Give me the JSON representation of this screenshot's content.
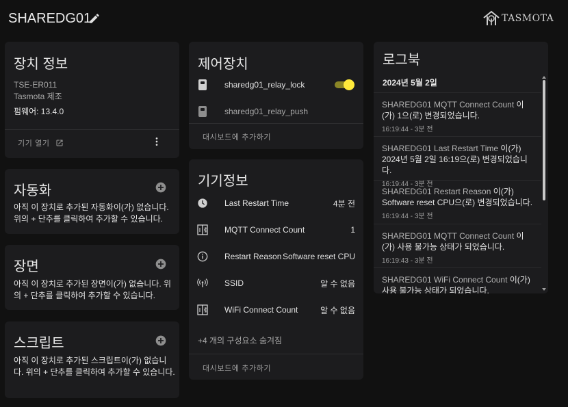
{
  "header": {
    "title": "SHAREDG01",
    "logo_text": "TASMOTA"
  },
  "device_info": {
    "title": "장치 정보",
    "model": "TSE-ER011",
    "manufacturer": "Tasmota 제조",
    "firmware": "펌웨어: 13.4.0",
    "open_device": "기기 열기"
  },
  "automation": {
    "title": "자동화",
    "empty_text": "아직 이 장치로 추가된 자동화이(가) 없습니다. 위의 + 단추를 클릭하여 추가할 수 있습니다."
  },
  "scenes": {
    "title": "장면",
    "empty_text": "아직 이 장치로 추가된 장면이(가) 없습니다. 위의 + 단추를 클릭하여 추가할 수 있습니다."
  },
  "scripts": {
    "title": "스크립트",
    "empty_text": "아직 이 장치로 추가된 스크립트이(가) 없습니다. 위의 + 단추를 클릭하여 추가할 수 있습니다."
  },
  "controls": {
    "title": "제어장치",
    "items": [
      {
        "label": "sharedg01_relay_lock",
        "state": "on"
      },
      {
        "label": "sharedg01_relay_push"
      }
    ],
    "add_to_dashboard": "대시보드에 추가하기"
  },
  "diagnostics": {
    "title": "기기정보",
    "rows": [
      {
        "icon": "clock-icon",
        "label": "Last Restart Time",
        "value": "4분 전"
      },
      {
        "icon": "counter-icon",
        "label": "MQTT Connect Count",
        "value": "1"
      },
      {
        "icon": "info-icon",
        "label": "Restart Reason",
        "value": "Software reset CPU"
      },
      {
        "icon": "wifi-antenna-icon",
        "label": "SSID",
        "value": "알 수 없음"
      },
      {
        "icon": "counter-icon",
        "label": "WiFi Connect Count",
        "value": "알 수 없음"
      }
    ],
    "hidden_entities": "+4 개의 구성요소 숨겨짐",
    "add_to_dashboard": "대시보드에 추가하기"
  },
  "logbook": {
    "title": "로그북",
    "date": "2024년 5월 2일",
    "entries": [
      {
        "name": "SHAREDG01 MQTT Connect Count",
        "text": "이(가) 1으(로) 변경되었습니다.",
        "time": "16:19:44 - 3분 전"
      },
      {
        "name": "SHAREDG01 Last Restart Time",
        "text": "이(가) 2024년 5월 2일 16:19으(로) 변경되었습니다.",
        "time": "16:19:44 - 3분 전"
      },
      {
        "name": "SHAREDG01 Restart Reason",
        "text": "이(가) Software reset CPU으(로) 변경되었습니다.",
        "time": "16:19:44 - 3분 전"
      },
      {
        "name": "SHAREDG01 MQTT Connect Count",
        "text": "이(가) 사용 불가능 상태가 되었습니다.",
        "time": "16:19:43 - 3분 전"
      },
      {
        "name": "SHAREDG01 WiFi Connect Count",
        "text": "이(가) 사용 불가능 상태가 되었습니다.",
        "time": ""
      }
    ]
  },
  "colors": {
    "background": "#111111",
    "card": "#1c1c1e",
    "toggle_on": "#ffeb3b",
    "toggle_track": "#8a8526"
  }
}
